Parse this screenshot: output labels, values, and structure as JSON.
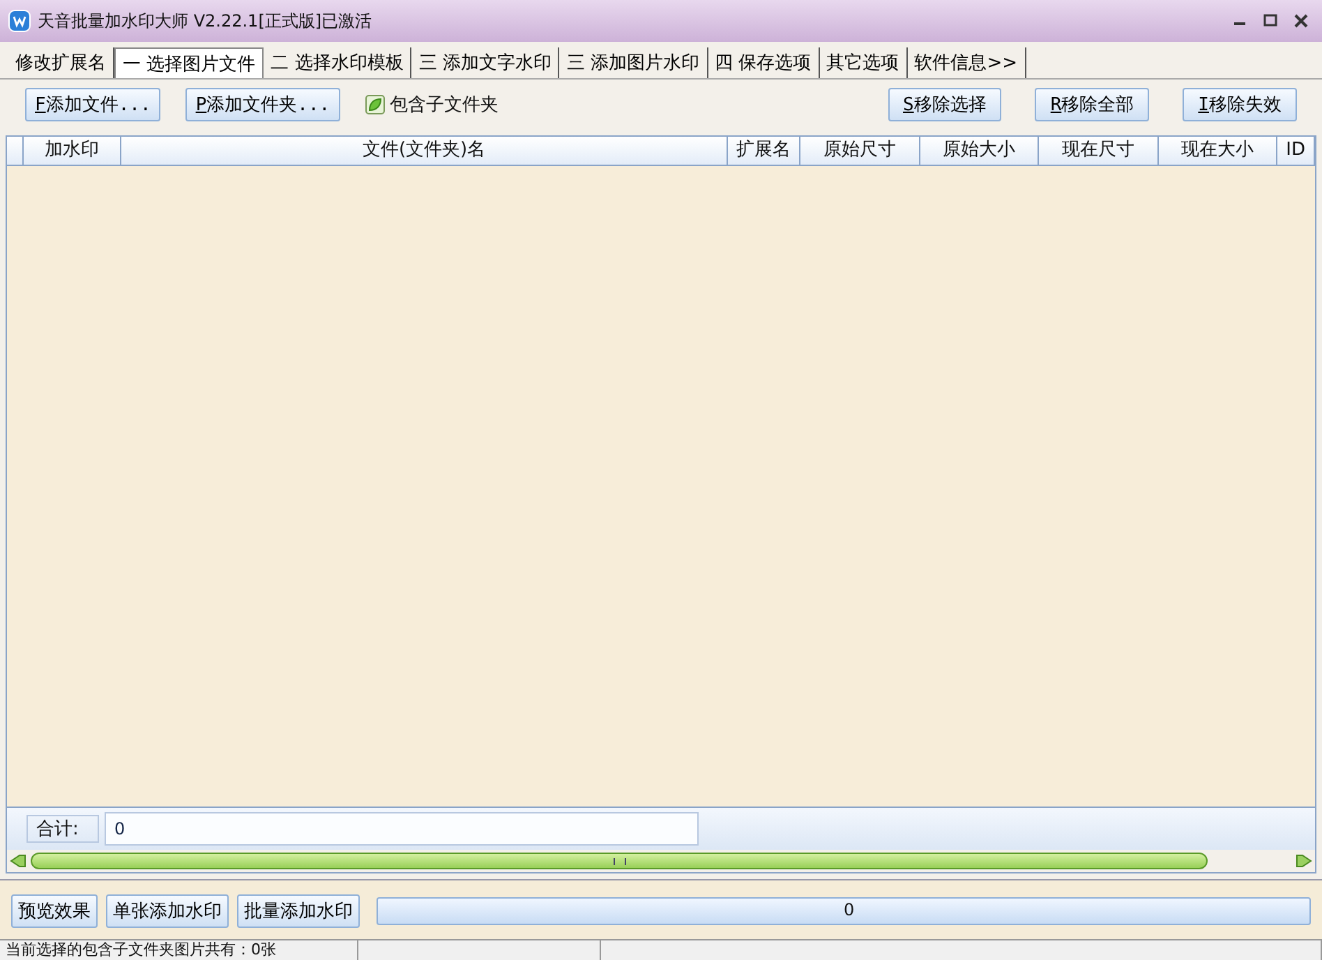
{
  "window": {
    "title": "天音批量加水印大师 V2.22.1[正式版]已激活"
  },
  "tabs": [
    {
      "label": "修改扩展名",
      "selected": false
    },
    {
      "label": "一  选择图片文件",
      "selected": true
    },
    {
      "label": "二  选择水印模板",
      "selected": false
    },
    {
      "label": "三  添加文字水印",
      "selected": false
    },
    {
      "label": "三  添加图片水印",
      "selected": false
    },
    {
      "label": "四  保存选项",
      "selected": false
    },
    {
      "label": "其它选项",
      "selected": false
    },
    {
      "label": "软件信息>>",
      "selected": false
    }
  ],
  "toolbar_left": [
    {
      "key": "F",
      "label": "添加文件..."
    },
    {
      "key": "P",
      "label": "添加文件夹..."
    }
  ],
  "include_subfolders": {
    "label": "包含子文件夹",
    "checked": true
  },
  "toolbar_right": [
    {
      "key": "S",
      "label": "移除选择"
    },
    {
      "key": "R",
      "label": "移除全部"
    },
    {
      "key": "I",
      "label": "移除失效"
    }
  ],
  "table": {
    "columns": [
      "加水印",
      "文件(文件夹)名",
      "扩展名",
      "原始尺寸",
      "原始大小",
      "现在尺寸",
      "现在大小",
      "ID"
    ]
  },
  "total": {
    "label": "合计:",
    "value": "0"
  },
  "actions": [
    "预览效果",
    "单张添加水印",
    "批量添加水印"
  ],
  "progress": {
    "level": 0,
    "reading": "0"
  },
  "status_bar": [
    "当前选择的包含子文件夹图片共有：0张"
  ]
}
